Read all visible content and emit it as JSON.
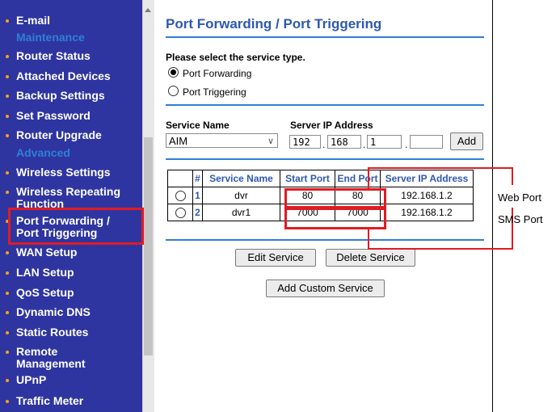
{
  "sidebar": {
    "items": [
      {
        "label": "E-mail"
      },
      {
        "section": "Maintenance"
      },
      {
        "label": "Router Status"
      },
      {
        "label": "Attached Devices"
      },
      {
        "label": "Backup Settings"
      },
      {
        "label": "Set Password"
      },
      {
        "label": "Router Upgrade"
      },
      {
        "section": "Advanced"
      },
      {
        "label": "Wireless Settings"
      },
      {
        "label_line1": "Wireless Repeating",
        "label_line2": "Function"
      },
      {
        "label_line1": "Port Forwarding /",
        "label_line2": "Port Triggering"
      },
      {
        "label": "WAN Setup"
      },
      {
        "label": "LAN Setup"
      },
      {
        "label": "QoS Setup"
      },
      {
        "label": "Dynamic DNS"
      },
      {
        "label": "Static Routes"
      },
      {
        "label_line1": "Remote",
        "label_line2": "Management"
      },
      {
        "label": "UPnP"
      },
      {
        "label": "Traffic Meter"
      }
    ]
  },
  "page": {
    "title": "Port Forwarding / Port Triggering",
    "service_type_prompt": "Please select the service type.",
    "radio_port_forwarding": "Port Forwarding",
    "radio_port_triggering": "Port Triggering",
    "service_name_label": "Service Name",
    "server_ip_label": "Server IP Address",
    "service_select_value": "AIM",
    "ip": [
      "192",
      "168",
      "1",
      ""
    ],
    "add_button": "Add",
    "edit_button": "Edit Service",
    "delete_button": "Delete Service",
    "add_custom_button": "Add Custom Service"
  },
  "table": {
    "headers": [
      "#",
      "Service Name",
      "Start Port",
      "End Port",
      "Server IP Address"
    ],
    "rows": [
      {
        "num": "1",
        "service": "dvr",
        "start": "80",
        "end": "80",
        "ip": "192.168.1.2"
      },
      {
        "num": "2",
        "service": "dvr1",
        "start": "7000",
        "end": "7000",
        "ip": "192.168.1.2"
      }
    ]
  },
  "annotations": {
    "web_port": "Web Port",
    "sms_port": "SMS Port"
  },
  "colors": {
    "sidebar_bg": "#2f35a0",
    "section_blue": "#2f7fd9",
    "title_blue": "#2f58b0",
    "bullet_orange": "#f7a11a",
    "highlight_red": "#e01b24"
  }
}
